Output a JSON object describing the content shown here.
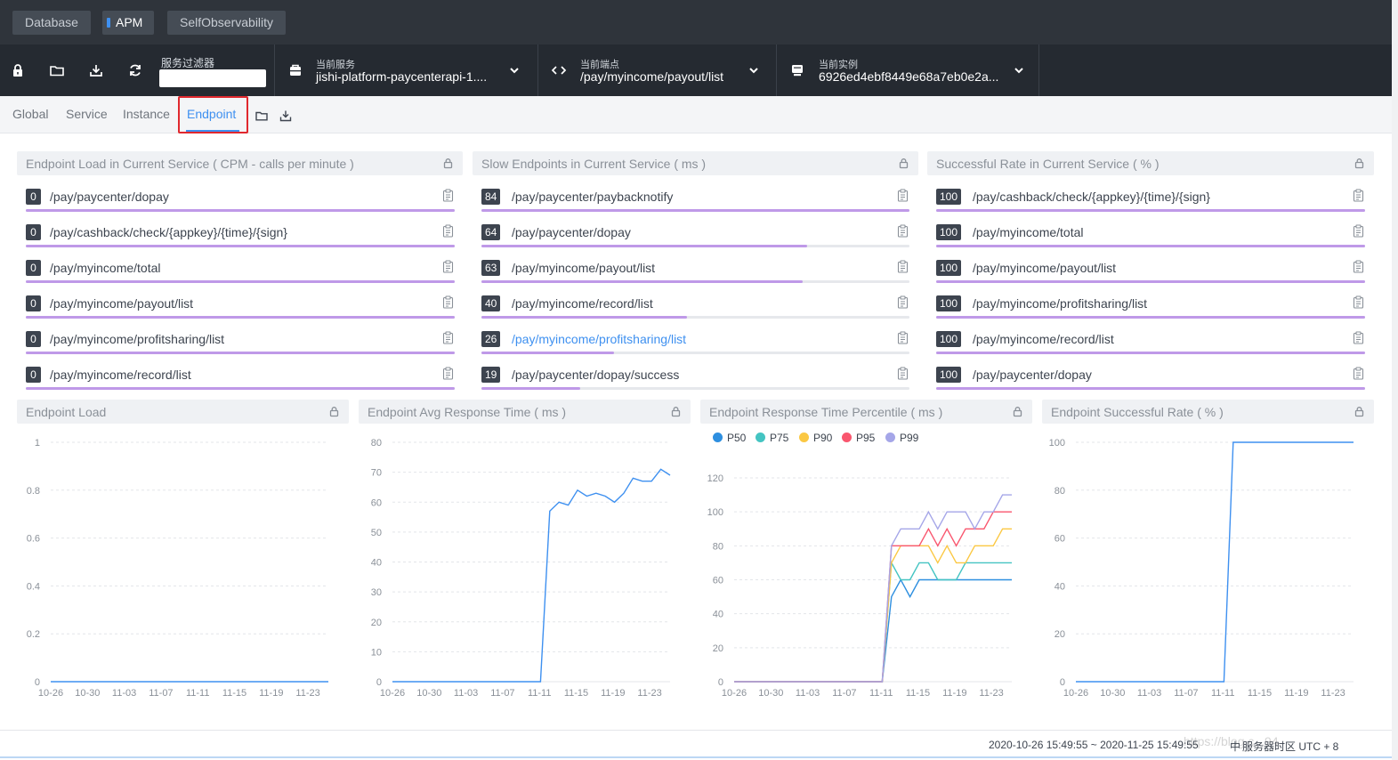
{
  "topnav": {
    "tabs": [
      {
        "label": "Database",
        "active": false
      },
      {
        "label": "APM",
        "active": true
      },
      {
        "label": "SelfObservability",
        "active": false
      }
    ]
  },
  "toolbar": {
    "filter_label": "服务过滤器",
    "filter_value": "",
    "service": {
      "label": "当前服务",
      "value": "jishi-platform-paycenterapi-1...."
    },
    "endpoint": {
      "label": "当前端点",
      "value": "/pay/myincome/payout/list"
    },
    "instance": {
      "label": "当前实例",
      "value": "6926ed4ebf8449e68a7eb0e2a..."
    }
  },
  "pagetabs": {
    "tabs": [
      {
        "label": "Global",
        "active": false
      },
      {
        "label": "Service",
        "active": false
      },
      {
        "label": "Instance",
        "active": false
      },
      {
        "label": "Endpoint",
        "active": true
      }
    ]
  },
  "panels": {
    "load": {
      "title": "Endpoint Load in Current Service ( CPM - calls per minute )",
      "rows": [
        {
          "value": "0",
          "endpoint": "/pay/paycenter/dopay",
          "fill": 1.0
        },
        {
          "value": "0",
          "endpoint": "/pay/cashback/check/{appkey}/{time}/{sign}",
          "fill": 1.0
        },
        {
          "value": "0",
          "endpoint": "/pay/myincome/total",
          "fill": 1.0
        },
        {
          "value": "0",
          "endpoint": "/pay/myincome/payout/list",
          "fill": 1.0
        },
        {
          "value": "0",
          "endpoint": "/pay/myincome/profitsharing/list",
          "fill": 1.0
        },
        {
          "value": "0",
          "endpoint": "/pay/myincome/record/list",
          "fill": 1.0
        }
      ]
    },
    "slow": {
      "title": "Slow Endpoints in Current Service ( ms )",
      "rows": [
        {
          "value": "84",
          "endpoint": "/pay/paycenter/paybacknotify",
          "fill": 1.0
        },
        {
          "value": "64",
          "endpoint": "/pay/paycenter/dopay",
          "fill": 0.76
        },
        {
          "value": "63",
          "endpoint": "/pay/myincome/payout/list",
          "fill": 0.75
        },
        {
          "value": "40",
          "endpoint": "/pay/myincome/record/list",
          "fill": 0.48
        },
        {
          "value": "26",
          "endpoint": "/pay/myincome/profitsharing/list",
          "fill": 0.31,
          "link": true
        },
        {
          "value": "19",
          "endpoint": "/pay/paycenter/dopay/success",
          "fill": 0.23
        }
      ]
    },
    "success": {
      "title": "Successful Rate in Current Service ( % )",
      "rows": [
        {
          "value": "100",
          "endpoint": "/pay/cashback/check/{appkey}/{time}/{sign}",
          "fill": 1.0
        },
        {
          "value": "100",
          "endpoint": "/pay/myincome/total",
          "fill": 1.0
        },
        {
          "value": "100",
          "endpoint": "/pay/myincome/payout/list",
          "fill": 1.0
        },
        {
          "value": "100",
          "endpoint": "/pay/myincome/profitsharing/list",
          "fill": 1.0
        },
        {
          "value": "100",
          "endpoint": "/pay/myincome/record/list",
          "fill": 1.0
        },
        {
          "value": "100",
          "endpoint": "/pay/paycenter/dopay",
          "fill": 1.0
        }
      ]
    }
  },
  "charts_titles": {
    "load": "Endpoint Load",
    "avg": "Endpoint Avg Response Time ( ms )",
    "pct": "Endpoint Response Time Percentile ( ms )",
    "sr": "Endpoint Successful Rate ( % )"
  },
  "colors": {
    "accent": "#3e90f0",
    "bar": "#bf99e8",
    "line": "#3e90f0",
    "highlight": "#e0282e"
  },
  "chart_data": [
    {
      "type": "line",
      "title": "Endpoint Load",
      "categories": [
        "10-26",
        "10-30",
        "11-03",
        "11-07",
        "11-11",
        "11-15",
        "11-19",
        "11-23"
      ],
      "ylim": [
        0,
        1
      ],
      "yticks": [
        "0",
        "0.2",
        "0.4",
        "0.6",
        "0.8",
        "1"
      ],
      "series": [
        {
          "values": [
            0,
            0,
            0,
            0,
            0,
            0,
            0,
            0,
            0,
            0,
            0,
            0,
            0,
            0,
            0,
            0,
            0,
            0,
            0,
            0,
            0,
            0,
            0,
            0,
            0,
            0,
            0,
            0,
            0,
            0,
            0
          ]
        }
      ]
    },
    {
      "type": "line",
      "title": "Endpoint Avg Response Time ( ms )",
      "categories": [
        "10-26",
        "10-30",
        "11-03",
        "11-07",
        "11-11",
        "11-15",
        "11-19",
        "11-23"
      ],
      "ylim": [
        0,
        80
      ],
      "yticks": [
        "0",
        "10",
        "20",
        "30",
        "40",
        "50",
        "60",
        "70",
        "80"
      ],
      "series": [
        {
          "values": [
            0,
            0,
            0,
            0,
            0,
            0,
            0,
            0,
            0,
            0,
            0,
            0,
            0,
            0,
            0,
            0,
            0,
            57,
            60,
            59,
            64,
            62,
            63,
            62,
            60,
            63,
            68,
            67,
            67,
            71,
            69
          ]
        }
      ]
    },
    {
      "type": "line",
      "title": "Endpoint Response Time Percentile ( ms )",
      "categories": [
        "10-26",
        "10-30",
        "11-03",
        "11-07",
        "11-11",
        "11-15",
        "11-19",
        "11-23"
      ],
      "ylim": [
        0,
        120
      ],
      "yticks": [
        "0",
        "20",
        "40",
        "60",
        "80",
        "100",
        "120"
      ],
      "legend": [
        "P50",
        "P75",
        "P90",
        "P95",
        "P99"
      ],
      "series": [
        {
          "name": "P50",
          "color": "#2e8fe0",
          "values": [
            0,
            0,
            0,
            0,
            0,
            0,
            0,
            0,
            0,
            0,
            0,
            0,
            0,
            0,
            0,
            0,
            0,
            50,
            60,
            50,
            60,
            60,
            60,
            60,
            60,
            60,
            60,
            60,
            60,
            60,
            60
          ]
        },
        {
          "name": "P75",
          "color": "#44c4c2",
          "values": [
            0,
            0,
            0,
            0,
            0,
            0,
            0,
            0,
            0,
            0,
            0,
            0,
            0,
            0,
            0,
            0,
            0,
            70,
            60,
            60,
            70,
            70,
            60,
            60,
            60,
            70,
            70,
            70,
            70,
            70,
            70
          ]
        },
        {
          "name": "P90",
          "color": "#fbc843",
          "values": [
            0,
            0,
            0,
            0,
            0,
            0,
            0,
            0,
            0,
            0,
            0,
            0,
            0,
            0,
            0,
            0,
            0,
            70,
            80,
            80,
            80,
            80,
            70,
            80,
            70,
            70,
            80,
            80,
            80,
            90,
            90
          ]
        },
        {
          "name": "P95",
          "color": "#f9566e",
          "values": [
            0,
            0,
            0,
            0,
            0,
            0,
            0,
            0,
            0,
            0,
            0,
            0,
            0,
            0,
            0,
            0,
            0,
            80,
            80,
            80,
            80,
            90,
            80,
            90,
            80,
            90,
            90,
            90,
            100,
            100,
            100
          ]
        },
        {
          "name": "P99",
          "color": "#a5a6e8",
          "values": [
            0,
            0,
            0,
            0,
            0,
            0,
            0,
            0,
            0,
            0,
            0,
            0,
            0,
            0,
            0,
            0,
            0,
            80,
            90,
            90,
            90,
            100,
            90,
            100,
            100,
            100,
            90,
            100,
            100,
            110,
            110
          ]
        }
      ]
    },
    {
      "type": "line",
      "title": "Endpoint Successful Rate ( % )",
      "categories": [
        "10-26",
        "10-30",
        "11-03",
        "11-07",
        "11-11",
        "11-15",
        "11-19",
        "11-23"
      ],
      "ylim": [
        0,
        100
      ],
      "yticks": [
        "0",
        "20",
        "40",
        "60",
        "80",
        "100"
      ],
      "series": [
        {
          "values": [
            0,
            0,
            0,
            0,
            0,
            0,
            0,
            0,
            0,
            0,
            0,
            0,
            0,
            0,
            0,
            0,
            0,
            100,
            100,
            100,
            100,
            100,
            100,
            100,
            100,
            100,
            100,
            100,
            100,
            100,
            100
          ]
        }
      ]
    }
  ],
  "footer": {
    "range": "2020-10-26 15:49:55 ~ 2020-11-25 15:49:55",
    "sep": "中",
    "timezone": "服务器时区 UTC + 8",
    "watermark": "https://blog.c...94"
  }
}
